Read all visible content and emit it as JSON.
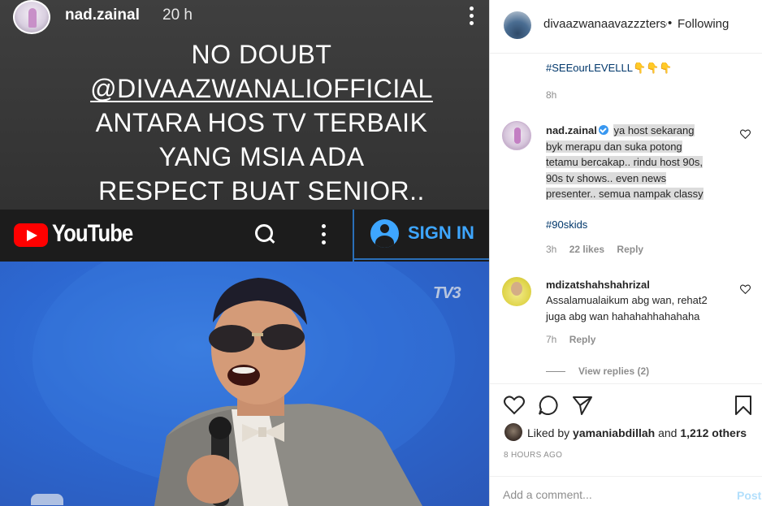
{
  "story": {
    "username": "nad.zainal",
    "time": "20 h",
    "text_lines": [
      "NO DOUBT",
      "@DIVAAZWANALIOFFICIAL",
      "ANTARA HOS TV TERBAIK",
      "YANG MSIA ADA",
      "RESPECT BUAT SENIOR.."
    ],
    "youtube": {
      "logo_text": "YouTube",
      "sign_in_label": "SIGN IN",
      "icons": [
        "youtube-logo-icon",
        "search-icon",
        "more-vertical-icon",
        "account-circle-icon"
      ]
    },
    "video": {
      "channel_logo": "TV3"
    }
  },
  "panel": {
    "header": {
      "username": "divaazwanaavazzztersc",
      "separator": "•",
      "follow_status": "Following"
    },
    "caption_tail": {
      "hashtag": "#SEEourLEVELLL👇👇👇",
      "time": "8h"
    },
    "comments": [
      {
        "username": "nad.zainal",
        "verified": true,
        "text_lines": [
          "ya host sekarang",
          "byk merapu dan suka potong",
          "tetamu bercakap.. rindu host 90s,",
          "90s tv shows.. even news",
          "presenter.. semua nampak classy"
        ],
        "hashtag": "#90skids",
        "time": "3h",
        "likes": "22 likes",
        "reply": "Reply"
      },
      {
        "username": "mdizatshahshahrizal",
        "verified": false,
        "text_lines": [
          "Assalamualaikum abg wan, rehat2",
          "juga abg wan hahahahhahahaha"
        ],
        "time": "7h",
        "reply": "Reply",
        "view_replies": "View replies (2)"
      }
    ],
    "likes": {
      "prefix": "Liked by",
      "user": "yamaniabdillah",
      "connector": "and",
      "others": "1,212 others"
    },
    "post_time": "8 HOURS AGO",
    "add_comment": {
      "placeholder": "Add a comment...",
      "post_label": "Post"
    },
    "colors": {
      "link": "#00376b",
      "muted": "#8e8e8e",
      "post_disabled": "#b2dffc",
      "verified": "#3897f0",
      "youtube_red": "#ff0000",
      "sign_in_blue": "#3ea6ff"
    }
  }
}
